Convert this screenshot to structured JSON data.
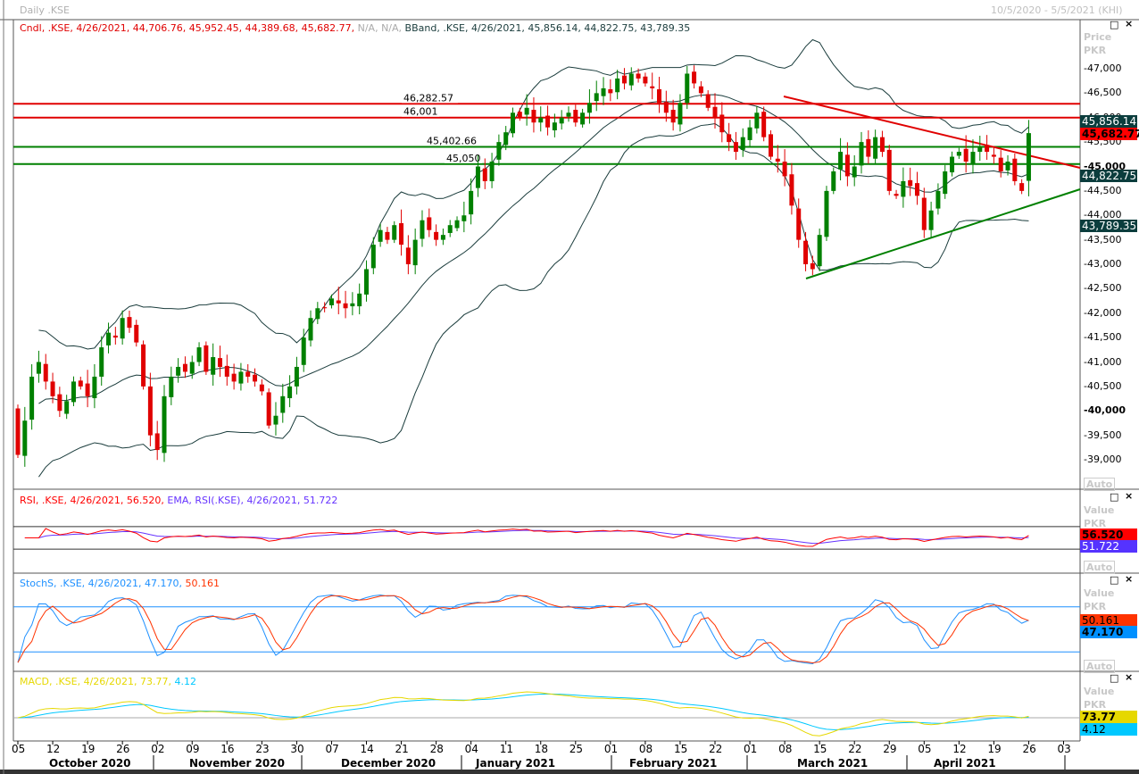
{
  "header": {
    "title": "Daily .KSE",
    "range": "10/5/2020 - 5/5/2021 (KHI)"
  },
  "legend": {
    "cndl": "Cndl, .KSE, 4/26/2021, 44,706.76, 45,952.45, 44,389.68, 45,682.77,",
    "cndl_na": "N/A, N/A,",
    "bband": "BBand, .KSE, 4/26/2021, 45,856.14, 44,822.75, 43,789.35",
    "rsi": "RSI, .KSE, 4/26/2021, 56.520,",
    "ema": "EMA, RSI(.KSE), 4/26/2021, 51.722",
    "stoch": "StochS, .KSE, 4/26/2021, 47.170,",
    "stoch2": "50.161",
    "macd": "MACD, .KSE, 4/26/2021, 73.77,",
    "macd2": "4.12"
  },
  "axis": {
    "price": "Price",
    "ccy": "PKR",
    "value": "Value",
    "auto": "Auto",
    "ticks": [
      "47,000",
      "46,500",
      "46,000",
      "45,500",
      "45,000",
      "44,500",
      "44,000",
      "43,500",
      "43,000",
      "42,500",
      "42,000",
      "41,500",
      "41,000",
      "40,500",
      "40,000",
      "39,500",
      "39,000"
    ],
    "tick_values": [
      47000,
      46500,
      46000,
      45500,
      45000,
      44500,
      44000,
      43500,
      43000,
      42500,
      42000,
      41500,
      41000,
      40500,
      40000,
      39500,
      39000
    ]
  },
  "badges": {
    "bb_upper": "45,856.14",
    "close": "45,682.77",
    "bb_mid": "44,822.75",
    "bb_lower": "43,789.35",
    "rsi": "56.520",
    "rsi_ema": "51.722",
    "stoch_d": "50.161",
    "stoch_k": "47.170",
    "macd": "73.77",
    "signal": "4.12"
  },
  "colors": {
    "up": "#008000",
    "down": "#e00000",
    "band": "#1a3c3c",
    "rsi": "#ff0000",
    "ema": "#6633ff",
    "stochk": "#1e90ff",
    "stochd": "#ff3300",
    "macd": "#e6d800",
    "signal": "#00c8ff"
  },
  "xaxis": {
    "days": [
      "05",
      "12",
      "19",
      "26",
      "02",
      "09",
      "16",
      "23",
      "30",
      "07",
      "14",
      "21",
      "28",
      "04",
      "11",
      "18",
      "25",
      "01",
      "08",
      "15",
      "22",
      "01",
      "08",
      "15",
      "22",
      "29",
      "05",
      "12",
      "19",
      "26",
      "03"
    ],
    "months": [
      "October 2020",
      "November 2020",
      "December 2020",
      "January 2021",
      "February 2021",
      "March 2021",
      "April 2021"
    ]
  },
  "chart_data": {
    "type": "candlestick",
    "title": "Daily .KSE",
    "ylabel": "Price PKR",
    "ylim": [
      38500,
      47600
    ],
    "start": "2020-10-05",
    "end": "2021-04-26",
    "first_open": 40050,
    "closes": [
      39100,
      39800,
      40700,
      41000,
      40600,
      40300,
      40000,
      40200,
      40600,
      40500,
      40300,
      40700,
      41300,
      41600,
      41500,
      41900,
      41700,
      41400,
      40500,
      39500,
      39200,
      40300,
      40700,
      40900,
      40800,
      41000,
      41300,
      40800,
      41100,
      40900,
      40700,
      40600,
      40800,
      40700,
      40600,
      40400,
      39700,
      39900,
      40300,
      40500,
      40900,
      41500,
      41900,
      42100,
      42100,
      42300,
      42200,
      42100,
      42200,
      42400,
      42900,
      43400,
      43700,
      43500,
      43800,
      43400,
      43000,
      43500,
      43900,
      43700,
      43500,
      43600,
      43800,
      43900,
      44000,
      44500,
      45000,
      44700,
      45100,
      45500,
      45700,
      46100,
      46000,
      46200,
      45900,
      46000,
      45800,
      45900,
      46000,
      46100,
      45900,
      46100,
      46300,
      46500,
      46600,
      46500,
      46800,
      46700,
      46900,
      46800,
      46700,
      46600,
      46300,
      46100,
      45900,
      46300,
      46900,
      46700,
      46500,
      46200,
      46000,
      45700,
      45500,
      45300,
      45600,
      45800,
      46100,
      45600,
      45200,
      45100,
      44800,
      44200,
      43500,
      43000,
      42900,
      43600,
      44500,
      44900,
      45300,
      44800,
      45000,
      45500,
      45200,
      45600,
      45300,
      44500,
      44400,
      44700,
      44600,
      44400,
      43700,
      44100,
      44500,
      44900,
      45200,
      45300,
      45100,
      45300,
      45400,
      45300,
      45200,
      44900,
      45100,
      44700,
      44500
    ],
    "last": {
      "date": "4/26/2021",
      "open": 44706.76,
      "high": 45952.45,
      "low": 44389.68,
      "close": 45682.77
    },
    "bollinger_last": {
      "upper": 45856.14,
      "middle": 44822.75,
      "lower": 43789.35
    },
    "levels": [
      {
        "label": "46,282.57",
        "value": 46282.57,
        "color": "red"
      },
      {
        "label": "46,001",
        "value": 46001,
        "color": "red"
      },
      {
        "label": "45,402.66",
        "value": 45402.66,
        "color": "green"
      },
      {
        "label": "45,050",
        "value": 45050,
        "color": "green"
      }
    ],
    "trendlines": [
      {
        "color": "red",
        "from": [
          "2021-03-08",
          46450
        ],
        "to": [
          "2021-05-05",
          45000
        ]
      },
      {
        "color": "green",
        "from": [
          "2021-03-11",
          42700
        ],
        "to": [
          "2021-05-05",
          44500
        ]
      }
    ],
    "rsi_bands": [
      30,
      70
    ],
    "stoch_bands": [
      20,
      80
    ]
  }
}
